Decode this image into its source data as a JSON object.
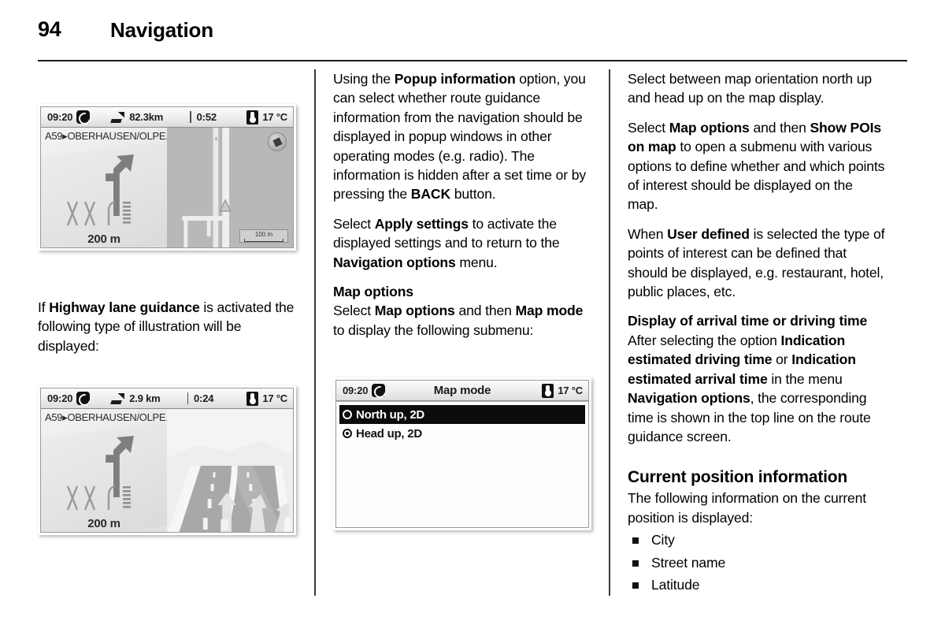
{
  "header": {
    "page_number": "94",
    "title": "Navigation"
  },
  "left_column": {
    "figure_route_guidance": {
      "status": {
        "time": "09:20",
        "tmc_icon": "tmc-clock-icon",
        "route_icon": "route-arrow-icon",
        "distance": "82.3km",
        "separator": "|",
        "eta": "0:52",
        "thermometer_icon": "thermometer-icon",
        "temperature": "17 °C"
      },
      "street": "A59▸OBERHAUSEN/OLPE...",
      "maneuver_distance": "200 m",
      "compass_icon": "compass-icon",
      "scale_label": "100 m"
    },
    "paragraph_lane_guidance": {
      "pre": "If ",
      "bold": "Highway lane guidance",
      "post": " is activated the following type of illustration will be displayed:"
    },
    "figure_lane_guidance": {
      "status": {
        "time": "09:20",
        "tmc_icon": "tmc-clock-icon",
        "route_icon": "route-arrow-icon",
        "distance": "2.9  km",
        "separator": "|",
        "eta": "0:24",
        "thermometer_icon": "thermometer-icon",
        "temperature": "17 °C"
      },
      "street": "A59▸OBERHAUSEN/OLPE...",
      "maneuver_distance": "200 m"
    }
  },
  "middle_column": {
    "paragraph_popup": {
      "s1": "Using the ",
      "b1": "Popup information",
      "s2": " option, you can select whether route guidance information from the navigation should be displayed in popup windows in other operating modes (e.g. radio). The information is hidden after a set time or by pressing the ",
      "b2": "BACK",
      "s3": " button."
    },
    "paragraph_apply": {
      "s1": "Select ",
      "b1": "Apply settings",
      "s2": " to activate the displayed settings and to return to the ",
      "b2": "Navigation options",
      "s3": " menu."
    },
    "heading_map_options": "Map options",
    "paragraph_map_mode": {
      "s1": "Select ",
      "b1": "Map options",
      "s2": " and then ",
      "b2": "Map mode",
      "s3": " to display the following submenu:"
    },
    "figure_map_mode": {
      "status": {
        "time": "09:20",
        "tmc_icon": "tmc-clock-icon",
        "title": "Map mode",
        "thermometer_icon": "thermometer-icon",
        "temperature": "17 °C"
      },
      "items": [
        {
          "label": "North up, 2D",
          "selected": true,
          "radio_on": false
        },
        {
          "label": "Head up, 2D",
          "selected": false,
          "radio_on": true
        }
      ]
    }
  },
  "right_column": {
    "paragraph_orientation": "Select between map orientation north up and head up on the map display.",
    "paragraph_pois": {
      "s1": "Select ",
      "b1": "Map options",
      "s2": " and then ",
      "b2": "Show POIs on map",
      "s3": " to open a submenu with various options to define whether and which points of interest should be displayed on the map."
    },
    "paragraph_user_defined": {
      "s1": "When ",
      "b1": "User defined",
      "s2": " is selected the type of points of interest can be defined that should be displayed, e.g. restaurant, hotel, public places, etc."
    },
    "heading_arrival": "Display of arrival time or driving time",
    "paragraph_arrival": {
      "s1": "After selecting the option ",
      "b1": "Indication estimated driving time",
      "s2": " or ",
      "b2": "Indication estimated arrival time",
      "s3": " in the menu ",
      "b3": "Navigation options",
      "s4": ", the corresponding time is shown in the top line on the route guidance screen."
    },
    "heading_current_position": "Current position information",
    "paragraph_current_position": "The following information on the current position is displayed:",
    "bullets": [
      "City",
      "Street name",
      "Latitude"
    ]
  }
}
